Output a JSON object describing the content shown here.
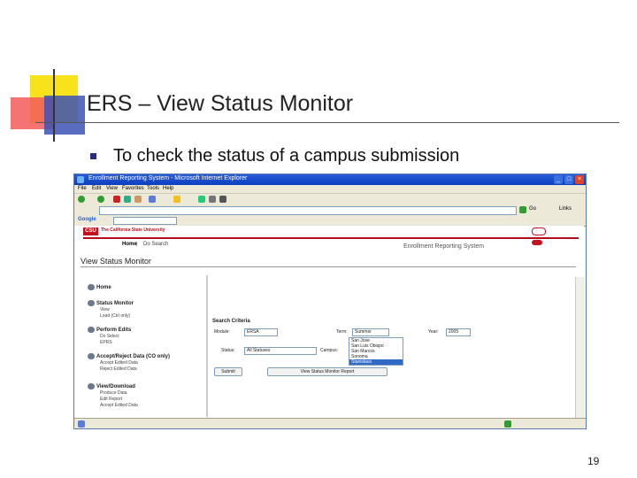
{
  "slide": {
    "title": "ERS – View Status Monitor",
    "bullet": "To check the status of a campus submission",
    "page_number": "19"
  },
  "browser": {
    "window_title": "Enrollment Reporting System - Microsoft Internet Explorer",
    "menu": [
      "File",
      "Edit",
      "View",
      "Favorites",
      "Tools",
      "Help"
    ],
    "go_label": "Go",
    "links_label": "Links",
    "google_label": "Google"
  },
  "page": {
    "university_name": "The California State University",
    "logo_text": "CSU",
    "nav_home": "Home",
    "nav_sep": "|",
    "nav_search": "Do Search",
    "system_title": "Enrollment Reporting System",
    "heading": "View Status Monitor",
    "sidebar": [
      {
        "group": "Home",
        "items": []
      },
      {
        "group": "Status Monitor",
        "items": [
          "View",
          "Load (Ctrl only)"
        ]
      },
      {
        "group": "Perform Edits",
        "items": [
          "Do Select",
          "EPRS"
        ]
      },
      {
        "group": "Accept/Reject Data (CO only)",
        "items": [
          "Accept Edited Data",
          "Reject Edited Data"
        ]
      },
      {
        "group": "View/Download",
        "items": [
          "Produce Data",
          "Edit Report",
          "Accept Edited Data"
        ]
      }
    ],
    "criteria": {
      "title": "Search Criteria",
      "module_label": "Module:",
      "module_value": "ERSA",
      "term_label": "Term:",
      "term_value": "Summer",
      "year_label": "Year:",
      "year_value": "2005",
      "status_label": "Status:",
      "status_value": "All Statuses",
      "campus_label": "Campus:",
      "campus_options": [
        "San Jose",
        "San Luis Obispo",
        "San Marcos",
        "Sonoma",
        "Stanislaus"
      ],
      "campus_selected": "Stanislaus",
      "submit_label": "Submit",
      "report_label": "View Status Monitor Report"
    }
  },
  "colors": {
    "title_bar": "#0b3fbf",
    "csu_red": "#c1121f",
    "slide_yellow": "#f7e21b",
    "slide_red": "#f35a5a",
    "slide_blue": "#3c52b4"
  }
}
